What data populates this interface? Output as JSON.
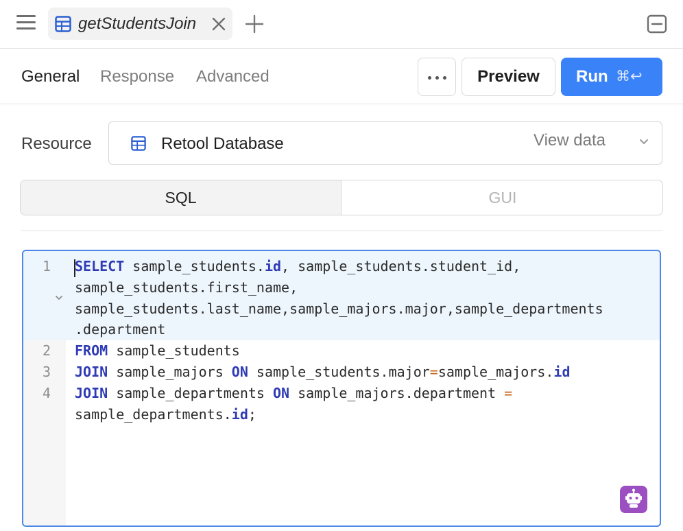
{
  "topbar": {
    "tab_title": "getStudentsJoin",
    "icons": [
      "menu-icon",
      "table-icon",
      "close-icon",
      "plus-icon",
      "collapse-panel-icon"
    ]
  },
  "subbar": {
    "tabs": [
      {
        "label": "General",
        "active": true
      },
      {
        "label": "Response",
        "active": false
      },
      {
        "label": "Advanced",
        "active": false
      }
    ],
    "preview_label": "Preview",
    "run_label": "Run",
    "run_shortcut": "⌘↩"
  },
  "resource": {
    "label": "Resource",
    "value": "Retool Database",
    "view_data_label": "View data"
  },
  "mode": {
    "options": [
      {
        "label": "SQL",
        "selected": true
      },
      {
        "label": "GUI",
        "selected": false
      }
    ]
  },
  "editor": {
    "line_numbers": [
      "1",
      "2",
      "3",
      "4"
    ],
    "lines": [
      "SELECT sample_students.id, sample_students.student_id,",
      "sample_students.first_name,",
      "sample_students.last_name,sample_majors.major,sample_departments",
      ".department",
      "FROM sample_students",
      "JOIN sample_majors ON sample_students.major=sample_majors.id",
      "JOIN sample_departments ON sample_majors.department =",
      "sample_departments.id;"
    ]
  },
  "colors": {
    "accent": "#3a82f7",
    "editor_border": "#4c86e8",
    "keyword": "#2f3bb4",
    "operator": "#c86418",
    "ai_button": "#9b4fc0"
  }
}
